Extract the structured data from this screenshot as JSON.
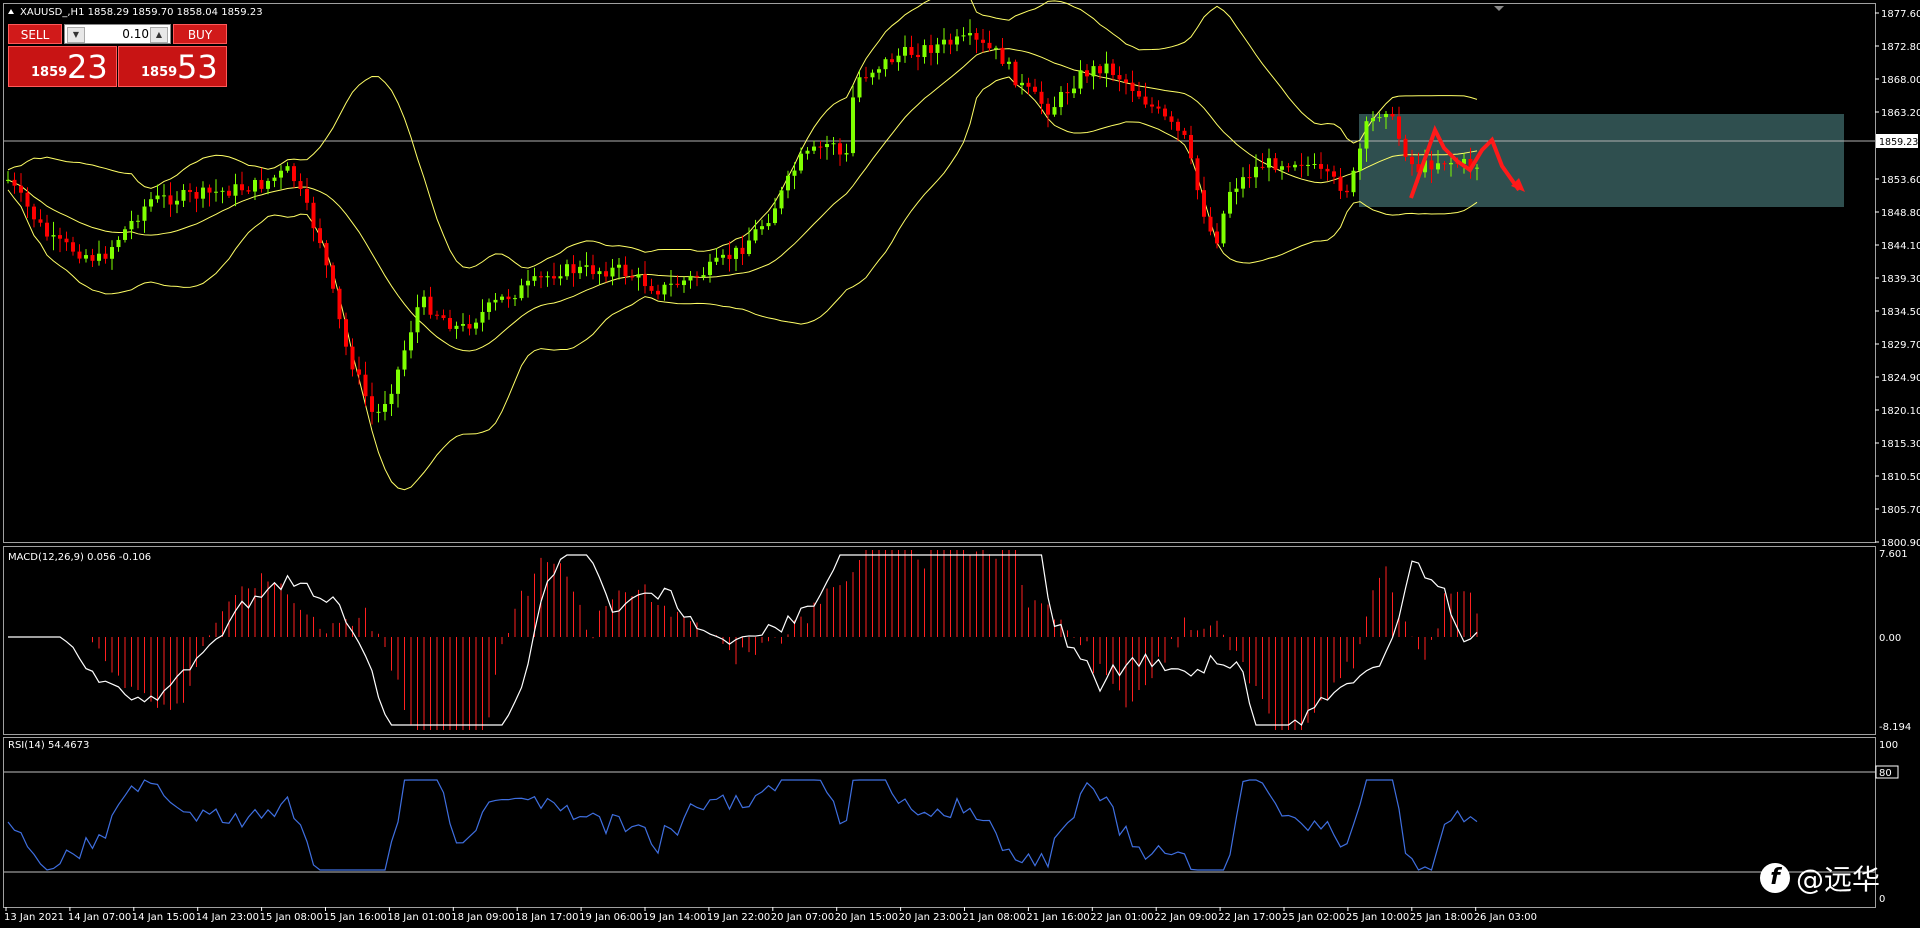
{
  "title": "XAUUSD_,H1  1858.29 1859.70 1858.04 1859.23",
  "trade_panel": {
    "sell_label": "SELL",
    "buy_label": "BUY",
    "lot": "0.10",
    "sell_prefix": "1859",
    "sell_big": "23",
    "buy_prefix": "1859",
    "buy_big": "53"
  },
  "price_axis": {
    "labels": [
      "1877.60",
      "1872.80",
      "1868.00",
      "1863.20",
      "1853.60",
      "1848.80",
      "1844.10",
      "1839.30",
      "1834.50",
      "1829.70",
      "1824.90",
      "1820.10",
      "1815.30",
      "1810.50",
      "1805.70",
      "1800.90"
    ],
    "current": "1859.23"
  },
  "macd": {
    "title": "MACD(12,26,9) 0.056 -0.106",
    "top": "7.601",
    "zero": "0.00",
    "bottom": "-8.194"
  },
  "rsi": {
    "title": "RSI(14) 54.4673",
    "top": "100",
    "level": "80",
    "bottom": "0"
  },
  "time_axis": [
    "13 Jan 2021",
    "14 Jan 07:00",
    "14 Jan 15:00",
    "14 Jan 23:00",
    "15 Jan 08:00",
    "15 Jan 16:00",
    "18 Jan 01:00",
    "18 Jan 09:00",
    "18 Jan 17:00",
    "19 Jan 06:00",
    "19 Jan 14:00",
    "19 Jan 22:00",
    "20 Jan 07:00",
    "20 Jan 15:00",
    "20 Jan 23:00",
    "21 Jan 08:00",
    "21 Jan 16:00",
    "22 Jan 01:00",
    "22 Jan 09:00",
    "22 Jan 17:00",
    "25 Jan 02:00",
    "25 Jan 10:00",
    "25 Jan 18:00",
    "26 Jan 03:00"
  ],
  "watermark": "@远华",
  "colors": {
    "bull": "#7fff00",
    "bear": "#ff0000",
    "band": "#ffff66",
    "rsi": "#3f6fe0",
    "zone": "#2f4f4f"
  },
  "chart_data": {
    "type": "candlestick",
    "ylim": [
      1800.9,
      1879.0
    ]
  }
}
